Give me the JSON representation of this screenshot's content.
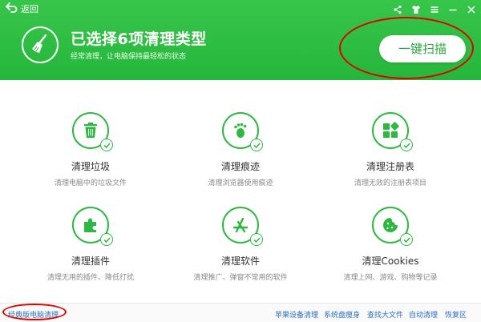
{
  "topbar": {
    "back_label": "返回"
  },
  "header": {
    "headline": "已选择6项清理类型",
    "subline": "经常清理，让电脑保持最轻松的状态",
    "scan_button": "一键扫描"
  },
  "items": [
    {
      "title": "清理垃圾",
      "desc": "清理电脑中的垃圾文件",
      "icon": "trash-icon"
    },
    {
      "title": "清理痕迹",
      "desc": "清理浏览器使用痕迹",
      "icon": "footprint-icon"
    },
    {
      "title": "清理注册表",
      "desc": "清理无效的注册表项目",
      "icon": "registry-blocks-icon"
    },
    {
      "title": "清理插件",
      "desc": "清理无用的插件、降低打扰",
      "icon": "puzzle-icon"
    },
    {
      "title": "清理软件",
      "desc": "清理推广、弹窗不常用的软件",
      "icon": "app-store-icon"
    },
    {
      "title": "清理Cookies",
      "desc": "清理上网、游戏、购物等记录",
      "icon": "cookie-icon"
    }
  ],
  "footer": {
    "classic": "经典版电脑清理",
    "links": [
      "苹果设备清理",
      "系统盘瘦身",
      "查找大文件",
      "自动清理",
      "恢复区"
    ]
  },
  "colors": {
    "brand_green": "#2eb842",
    "annotation_red": "#e00000",
    "link_blue": "#2a6fc1"
  }
}
